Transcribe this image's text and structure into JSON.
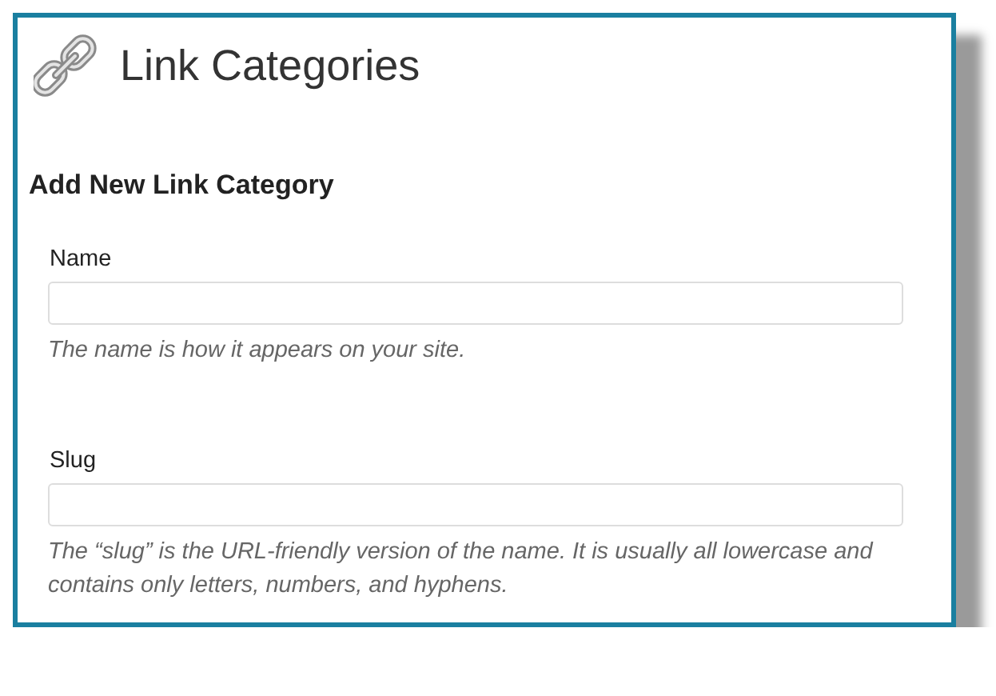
{
  "page": {
    "title": "Link Categories"
  },
  "form": {
    "heading": "Add New Link Category",
    "fields": [
      {
        "label": "Name",
        "description": "The name is how it appears on your site."
      },
      {
        "label": "Slug",
        "description": "The “slug” is the URL-friendly version of the name. It is usually all lowercase and contains only letters, numbers, and hyphens."
      }
    ]
  }
}
